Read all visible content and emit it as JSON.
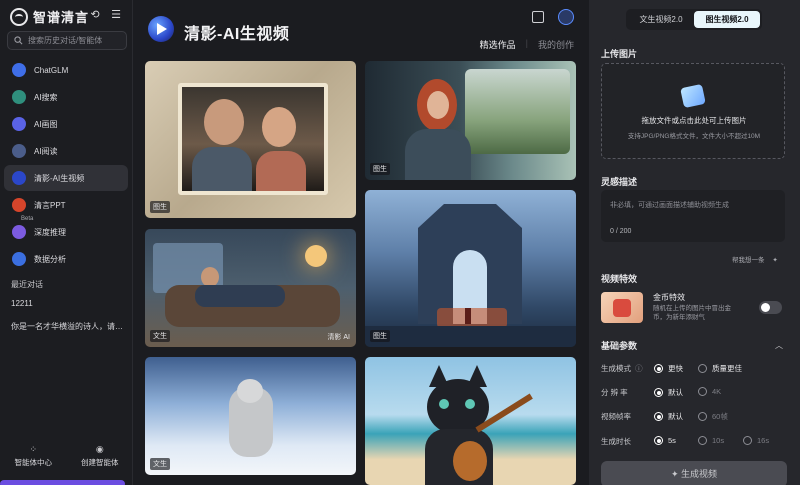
{
  "sidebar": {
    "brand": "智谱清言",
    "search_placeholder": "搜索历史对话/智能体",
    "nav": [
      {
        "label": "ChatGLM",
        "icon": "chatglm-icon",
        "color": "#3f6ee8"
      },
      {
        "label": "AI搜索",
        "icon": "ai-search-icon",
        "color": "#2f8f7d"
      },
      {
        "label": "AI画图",
        "icon": "ai-draw-icon",
        "color": "#5a63e6"
      },
      {
        "label": "AI阅读",
        "icon": "ai-read-icon",
        "color": "#4b5d8a"
      },
      {
        "label": "清影-AI生视频",
        "icon": "video-icon",
        "color": "#2b47c9"
      },
      {
        "label": "清言PPT",
        "icon": "ppt-icon",
        "color": "#d6452b"
      },
      {
        "label": "深度推理",
        "icon": "reasoning-icon",
        "color": "#7c5be0"
      },
      {
        "label": "数据分析",
        "icon": "data-analysis-icon",
        "color": "#3b6fe0"
      }
    ],
    "beta_badge": "Beta",
    "recent_label": "最近对话",
    "history": [
      "12211",
      "你是一名才华横溢的诗人，请根..."
    ],
    "bottom": [
      {
        "label": "智能体中心",
        "icon": "agent-center-icon"
      },
      {
        "label": "创建智能体",
        "icon": "create-agent-icon"
      }
    ]
  },
  "main": {
    "title": "清影-AI生视频",
    "tabs": [
      "精选作品",
      "我的创作"
    ],
    "cards": [
      {
        "tag": "图生"
      },
      {
        "tag": "图生"
      },
      {
        "tag": "文生",
        "watermark": "清影 AI"
      },
      {
        "tag": "图生"
      },
      {
        "tag": "文生"
      },
      {
        "tag": ""
      }
    ]
  },
  "panel": {
    "modes": [
      "文生视频2.0",
      "图生视频2.0"
    ],
    "upload_label": "上传图片",
    "upload_text": "拖放文件或点击此处可上传图片",
    "upload_hint": "支持JPG/PNG格式文件，文件大小不超过10M",
    "desc_label": "灵感描述",
    "desc_placeholder": "非必填，可通过画面描述辅助视频生成",
    "desc_count": "0 / 200",
    "helper": "帮我想一条",
    "fx_label": "视频特效",
    "fx_title": "金币特效",
    "fx_desc": "随机在上传的图片中冒出金币，为新年添财气",
    "basic_label": "基础参数",
    "rows": [
      {
        "label": "生成模式",
        "options": [
          "更快",
          "质量更佳"
        ],
        "selected": 0
      },
      {
        "label": "分 辨 率",
        "options": [
          "默认",
          "4K"
        ],
        "selected": 0
      },
      {
        "label": "视频帧率",
        "options": [
          "默认",
          "60帧"
        ],
        "selected": 0
      },
      {
        "label": "生成时长",
        "options": [
          "5s",
          "10s",
          "16s"
        ],
        "selected": 0
      }
    ],
    "generate": "生成视频"
  }
}
